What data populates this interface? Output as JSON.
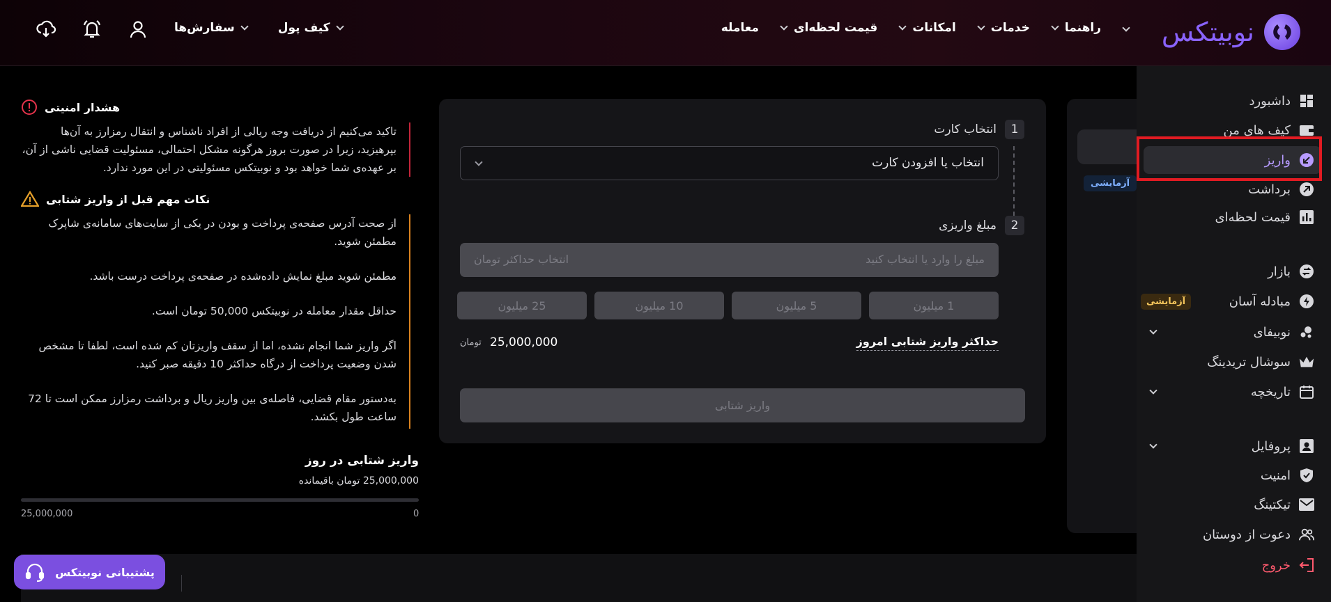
{
  "brand": {
    "name": "نوبیتکس",
    "color": "#8a63ff"
  },
  "nav": {
    "items": [
      {
        "label": "معامله",
        "has_chevron": true
      },
      {
        "label": "قیمت لحظه‌ای",
        "has_chevron": true
      },
      {
        "label": "امکانات",
        "has_chevron": true
      },
      {
        "label": "خدمات",
        "has_chevron": true
      },
      {
        "label": "راهنما",
        "has_chevron": true
      }
    ],
    "secondary": [
      {
        "label": "سفارش‌ها"
      },
      {
        "label": "کیف پول"
      }
    ],
    "icons": [
      "download-app-icon",
      "bell-icon",
      "user-icon"
    ]
  },
  "sidebar": {
    "items": [
      {
        "label": "داشبورد",
        "icon": "dashboard-icon"
      },
      {
        "label": "کیف های من",
        "icon": "wallet-icon"
      },
      {
        "label": "واریز",
        "icon": "deposit-icon",
        "active": true
      },
      {
        "label": "برداشت",
        "icon": "withdraw-icon"
      },
      {
        "label": "قیمت لحظه‌ای",
        "icon": "chart-icon"
      },
      {
        "label": "بازار",
        "icon": "market-icon"
      },
      {
        "label": "مبادله آسان",
        "icon": "bolt-icon",
        "badge": "آزمایشی"
      },
      {
        "label": "نوبیفای",
        "icon": "nobify-icon",
        "expandable": true
      },
      {
        "label": "سوشال تریدینگ",
        "icon": "crown-icon"
      },
      {
        "label": "تاریخچه",
        "icon": "calendar-icon",
        "expandable": true
      },
      {
        "label": "پروفایل",
        "icon": "profile-icon",
        "expandable": true
      },
      {
        "label": "امنیت",
        "icon": "shield-icon"
      },
      {
        "label": "تیکتینگ",
        "icon": "mail-icon"
      },
      {
        "label": "دعوت از دوستان",
        "icon": "users-icon"
      },
      {
        "label": "خروج",
        "icon": "logout-icon"
      }
    ]
  },
  "side_panel": {
    "badge": "آزمایشی"
  },
  "form": {
    "step1": {
      "num": "1",
      "label": "انتخاب کارت",
      "select_value": "انتخاب یا افزودن کارت"
    },
    "step2": {
      "num": "2",
      "label": "مبلغ واریزی",
      "placeholder": "مبلغ را وارد یا انتخاب کنید",
      "max_button": "انتخاب حداکثر  تومان"
    },
    "chips": [
      "1 میلیون",
      "5 میلیون",
      "10 میلیون",
      "25 میلیون"
    ],
    "max_today_label": "حداکثر واریز شتابی امروز",
    "max_today_value": "25,000,000",
    "max_today_unit": "تومان",
    "submit": "واریز شتابی"
  },
  "info": {
    "security_title": "هشدار امنیتی",
    "security_text": "تاکید می‌کنیم از دریافت وجه ریالی از افراد ناشناس و انتقال رمزارز به آن‌ها بپرهیزید، زیرا در صورت بروز هرگونه مشکل احتمالی، مسئولیت قضایی ناشی از آن، بر عهده‌ی شما خواهد بود و نوبیتکس مسئولیتی در این مورد ندارد.",
    "notes_title": "نکات مهم قبل از واریز شتابی",
    "notes": [
      "از صحت آدرس صفحه‌ی پرداخت و بودن در یکی از سایت‌های سامانه‌ی شاپرک مطمئن شوید.",
      "مطمئن شوید مبلغ نمایش داده‌شده در صفحه‌ی پرداخت درست باشد.",
      "حداقل مقدار معامله در نوبیتکس 50,000 تومان است.",
      "اگر واریز شما انجام نشده، اما از سقف واریزتان کم شده است، لطفا تا مشخص شدن وضعیت پرداخت از درگاه حداکثر 10 دقیقه صبر کنید.",
      "به‌دستور مقام قضایی، فاصله‌ی بین واریز ریال و برداشت رمزارز ممکن است تا 72 ساعت طول بکشد."
    ]
  },
  "daily": {
    "title": "واریز شتابی در روز",
    "remaining": "25,000,000 تومان باقیمانده",
    "min": "0",
    "max": "25,000,000",
    "used_fraction": 0
  },
  "support": {
    "label": "پشتیبانی نوبیتکس"
  },
  "colors": {
    "accent": "#8a63ff",
    "danger": "#e11b22",
    "warning": "#d9821f"
  }
}
